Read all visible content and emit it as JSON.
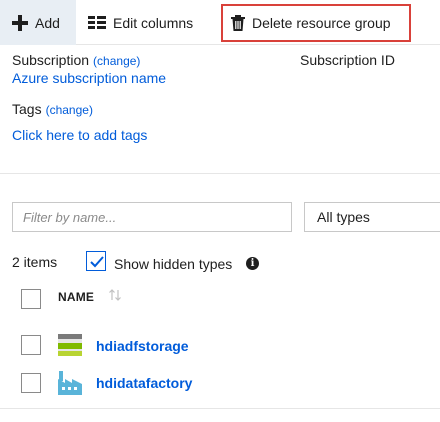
{
  "toolbar": {
    "add_label": "Add",
    "edit_columns_label": "Edit columns",
    "delete_label": "Delete resource group"
  },
  "essentials": {
    "subscription_label": "Subscription",
    "subscription_change": "(change)",
    "subscription_value": "Azure subscription name",
    "subscription_id_label": "Subscription ID",
    "tags_label": "Tags",
    "tags_change": "(change)",
    "tags_link": "Click here to add tags"
  },
  "filter": {
    "placeholder": "Filter by name...",
    "type_value": "All types"
  },
  "list": {
    "count": "2 items",
    "show_hidden_label": "Show hidden types",
    "show_hidden_checked": true,
    "column_name": "NAME",
    "rows": [
      {
        "name": "hdiadfstorage",
        "icon": "storage-account-icon"
      },
      {
        "name": "hdidatafactory",
        "icon": "data-factory-icon"
      }
    ]
  },
  "colors": {
    "accent": "#015cda",
    "highlight_border": "#d9413a",
    "storage_green": "#7fba00",
    "factory_blue": "#59b4d9"
  }
}
